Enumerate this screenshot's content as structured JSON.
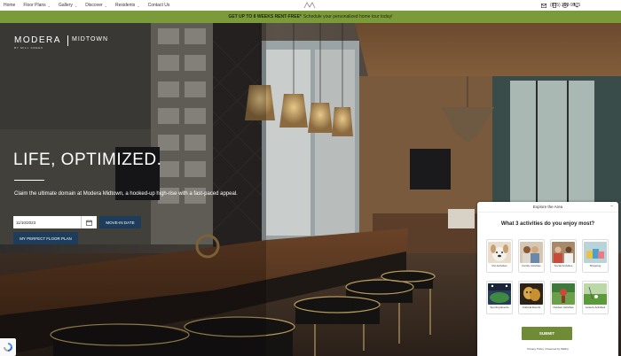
{
  "nav": {
    "items": [
      {
        "label": "Home",
        "dropdown": false
      },
      {
        "label": "Floor Plans",
        "dropdown": true
      },
      {
        "label": "Gallery",
        "dropdown": true
      },
      {
        "label": "Discover",
        "dropdown": true
      },
      {
        "label": "Residents",
        "dropdown": true
      },
      {
        "label": "Contact Us",
        "dropdown": false
      }
    ],
    "phone": "(855) 393-9975",
    "icons": [
      "mail-icon",
      "mobile-icon",
      "accessibility-icon",
      "phone-icon"
    ]
  },
  "promo": {
    "bold": "GET UP TO 8 WEEKS RENT-FREE*",
    "text": "Schedule your personalized home tour today!"
  },
  "hero": {
    "logo_main": "MODERA",
    "logo_sub": "BY MILL CREEK",
    "logo_right": "MIDTOWN",
    "headline": "LIFE, OPTIMIZED.",
    "tagline": "Claim the ultimate domain at Modera Midtown, a hooked-up high-rise with a fast-paced appeal.",
    "date_value": "11/10/2023",
    "move_in_label": "MOVE-IN DATE",
    "floor_plan_label": "MY PERFECT FLOOR PLAN"
  },
  "widget": {
    "title": "Explore the Area",
    "question": "What 3 activities do you enjoy most?",
    "activities": [
      {
        "label": "Pet Activities",
        "icon": "pet-photo"
      },
      {
        "label": "Family Activities",
        "icon": "family-photo"
      },
      {
        "label": "Social Activities",
        "icon": "social-photo"
      },
      {
        "label": "Shopping",
        "icon": "shopping-photo"
      },
      {
        "label": "Sporting Events",
        "icon": "stadium-photo"
      },
      {
        "label": "Cultural Events",
        "icon": "masks-photo"
      },
      {
        "label": "Outdoor Activities",
        "icon": "outdoor-photo"
      },
      {
        "label": "Leisure Activities",
        "icon": "golf-photo"
      }
    ],
    "submit": "SUBMIT",
    "footer_left": "Privacy Policy",
    "footer_right": "Powered by PERQ"
  },
  "colors": {
    "promo_green": "#7b9a3a",
    "button_blue": "#1e3d5c",
    "submit_green": "#6f8b35"
  }
}
